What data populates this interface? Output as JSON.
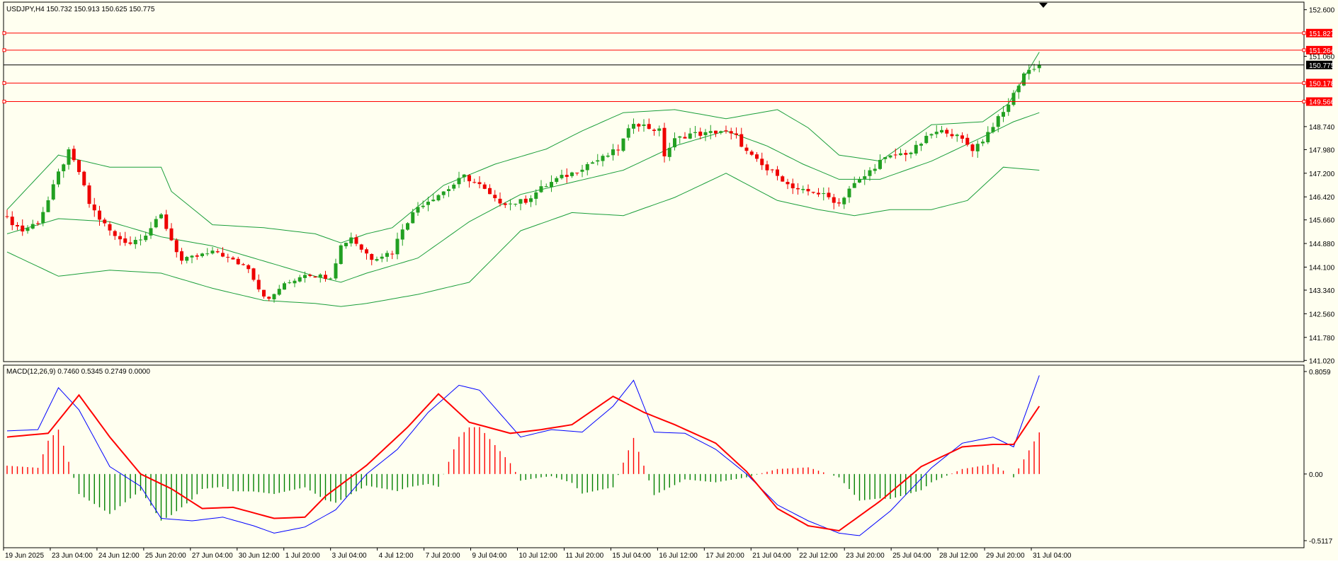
{
  "main_header": "USDJPY,H4  150.732 150.913 150.625 150.775",
  "macd_header": "MACD(12,26,9) 0.7460 0.5345 0.2749 0.0000",
  "colors": {
    "background": "#fffff0",
    "bull": "#22a022",
    "bear": "#ee0000",
    "bands": "#1a9e3a",
    "macd_line": "#0000ff",
    "signal_line": "#ff0000",
    "hist_pos": "#ff0000",
    "hist_neg": "#008000",
    "hline": "#ff0000",
    "price_line": "#000000"
  },
  "price_axis": {
    "ticks": [
      "152.600",
      "151.060",
      "148.740",
      "147.980",
      "147.200",
      "146.420",
      "145.660",
      "144.880",
      "144.100",
      "143.340",
      "142.560",
      "141.780",
      "141.020"
    ],
    "tick_values": [
      152.6,
      151.06,
      148.74,
      147.98,
      147.2,
      146.42,
      145.66,
      144.88,
      144.1,
      143.34,
      142.56,
      141.78,
      141.02
    ]
  },
  "macd_axis": {
    "ticks": [
      "0.8059",
      "0.00",
      "-0.5117"
    ],
    "tick_values": [
      0.8059,
      0.0,
      -0.5117
    ]
  },
  "horizontal_levels": [
    {
      "label": "151.827",
      "value": 151.827
    },
    {
      "label": "151.264",
      "value": 151.264
    },
    {
      "label": "150.178",
      "value": 150.178
    },
    {
      "label": "149.566",
      "value": 149.566
    }
  ],
  "current_price": {
    "label": "150.775",
    "value": 150.775
  },
  "time_labels": [
    "19 Jun 2025",
    "23 Jun 04:00",
    "24 Jun 12:00",
    "25 Jun 20:00",
    "27 Jun 04:00",
    "30 Jun 12:00",
    "1 Jul 20:00",
    "3 Jul 04:00",
    "4 Jul 12:00",
    "7 Jul 20:00",
    "9 Jul 04:00",
    "10 Jul 12:00",
    "11 Jul 20:00",
    "15 Jul 04:00",
    "16 Jul 12:00",
    "17 Jul 20:00",
    "21 Jul 04:00",
    "22 Jul 12:00",
    "23 Jul 20:00",
    "25 Jul 04:00",
    "28 Jul 12:00",
    "29 Jul 20:00",
    "31 Jul 04:00"
  ],
  "chart_data": {
    "type": "candlestick",
    "symbol": "USDJPY",
    "timeframe": "H4",
    "ylim": [
      140.98,
      152.85
    ],
    "close_path": [
      [
        0,
        145.7
      ],
      [
        3,
        145.3
      ],
      [
        6,
        145.6
      ],
      [
        8,
        146.3
      ],
      [
        10,
        147.2
      ],
      [
        12,
        147.9
      ],
      [
        14,
        147.25
      ],
      [
        16,
        146.2
      ],
      [
        18,
        145.7
      ],
      [
        21,
        145.1
      ],
      [
        24,
        144.9
      ],
      [
        27,
        145.2
      ],
      [
        30,
        145.8
      ],
      [
        32,
        145.0
      ],
      [
        34,
        144.3
      ],
      [
        36,
        144.4
      ],
      [
        38,
        144.5
      ],
      [
        41,
        144.6
      ],
      [
        44,
        144.3
      ],
      [
        47,
        144.1
      ],
      [
        49,
        143.4
      ],
      [
        51,
        143.0
      ],
      [
        53,
        143.4
      ],
      [
        55,
        143.6
      ],
      [
        58,
        143.9
      ],
      [
        61,
        143.8
      ],
      [
        63,
        143.8
      ],
      [
        65,
        144.8
      ],
      [
        67,
        145.1
      ],
      [
        69,
        144.7
      ],
      [
        71,
        144.4
      ],
      [
        73,
        144.5
      ],
      [
        75,
        144.6
      ],
      [
        77,
        145.4
      ],
      [
        80,
        146.1
      ],
      [
        83,
        146.4
      ],
      [
        86,
        146.7
      ],
      [
        89,
        147.1
      ],
      [
        92,
        146.8
      ],
      [
        95,
        146.3
      ],
      [
        98,
        146.2
      ],
      [
        101,
        146.3
      ],
      [
        104,
        146.7
      ],
      [
        107,
        147.0
      ],
      [
        110,
        147.2
      ],
      [
        113,
        147.5
      ],
      [
        116,
        147.7
      ],
      [
        119,
        148.0
      ],
      [
        122,
        148.9
      ],
      [
        125,
        148.7
      ],
      [
        127,
        148.6
      ],
      [
        128,
        147.8
      ],
      [
        130,
        148.3
      ],
      [
        133,
        148.5
      ],
      [
        136,
        148.5
      ],
      [
        139,
        148.6
      ],
      [
        142,
        148.4
      ],
      [
        144,
        147.9
      ],
      [
        146,
        147.6
      ],
      [
        148,
        147.3
      ],
      [
        150,
        147.2
      ],
      [
        152,
        146.8
      ],
      [
        154,
        146.6
      ],
      [
        157,
        146.6
      ],
      [
        160,
        146.4
      ],
      [
        162,
        146.2
      ],
      [
        164,
        146.7
      ],
      [
        167,
        147.1
      ],
      [
        170,
        147.6
      ],
      [
        173,
        147.8
      ],
      [
        176,
        147.9
      ],
      [
        178,
        148.2
      ],
      [
        180,
        148.5
      ],
      [
        183,
        148.6
      ],
      [
        186,
        148.3
      ],
      [
        188,
        148.0
      ],
      [
        190,
        148.3
      ],
      [
        192,
        148.8
      ],
      [
        194,
        149.2
      ],
      [
        196,
        149.8
      ],
      [
        198,
        150.5
      ],
      [
        200,
        150.7
      ],
      [
        201,
        150.78
      ]
    ],
    "bollinger_upper": [
      [
        0,
        146.0
      ],
      [
        10,
        147.8
      ],
      [
        20,
        147.4
      ],
      [
        30,
        147.4
      ],
      [
        32,
        146.6
      ],
      [
        40,
        145.5
      ],
      [
        50,
        145.4
      ],
      [
        60,
        145.2
      ],
      [
        65,
        144.9
      ],
      [
        70,
        145.2
      ],
      [
        75,
        145.4
      ],
      [
        85,
        146.8
      ],
      [
        95,
        147.5
      ],
      [
        105,
        148.0
      ],
      [
        112,
        148.6
      ],
      [
        120,
        149.2
      ],
      [
        130,
        149.3
      ],
      [
        140,
        149.0
      ],
      [
        150,
        149.3
      ],
      [
        156,
        148.7
      ],
      [
        162,
        147.8
      ],
      [
        170,
        147.6
      ],
      [
        180,
        148.8
      ],
      [
        190,
        148.9
      ],
      [
        195,
        149.5
      ],
      [
        201,
        151.2
      ]
    ],
    "bollinger_middle": [
      [
        0,
        145.2
      ],
      [
        10,
        145.7
      ],
      [
        20,
        145.6
      ],
      [
        30,
        145.1
      ],
      [
        40,
        144.8
      ],
      [
        50,
        144.3
      ],
      [
        60,
        143.8
      ],
      [
        65,
        143.6
      ],
      [
        70,
        143.9
      ],
      [
        80,
        144.4
      ],
      [
        90,
        145.6
      ],
      [
        100,
        146.5
      ],
      [
        110,
        146.9
      ],
      [
        120,
        147.3
      ],
      [
        130,
        148.1
      ],
      [
        140,
        148.6
      ],
      [
        148,
        148.1
      ],
      [
        155,
        147.5
      ],
      [
        162,
        147.0
      ],
      [
        170,
        147.0
      ],
      [
        180,
        147.6
      ],
      [
        190,
        148.4
      ],
      [
        196,
        148.9
      ],
      [
        201,
        149.2
      ]
    ],
    "bollinger_lower": [
      [
        0,
        144.6
      ],
      [
        10,
        143.8
      ],
      [
        20,
        144.0
      ],
      [
        30,
        143.9
      ],
      [
        40,
        143.4
      ],
      [
        50,
        143.0
      ],
      [
        60,
        142.9
      ],
      [
        65,
        142.8
      ],
      [
        70,
        142.9
      ],
      [
        80,
        143.2
      ],
      [
        90,
        143.6
      ],
      [
        100,
        145.3
      ],
      [
        110,
        145.9
      ],
      [
        120,
        145.8
      ],
      [
        130,
        146.4
      ],
      [
        140,
        147.2
      ],
      [
        150,
        146.3
      ],
      [
        158,
        146.0
      ],
      [
        165,
        145.8
      ],
      [
        172,
        146.0
      ],
      [
        180,
        146.0
      ],
      [
        187,
        146.3
      ],
      [
        194,
        147.4
      ],
      [
        201,
        147.3
      ]
    ],
    "macd": [
      [
        0,
        0.35
      ],
      [
        6,
        0.36
      ],
      [
        10,
        0.7
      ],
      [
        14,
        0.52
      ],
      [
        20,
        0.06
      ],
      [
        26,
        -0.1
      ],
      [
        30,
        -0.36
      ],
      [
        36,
        -0.38
      ],
      [
        42,
        -0.35
      ],
      [
        48,
        -0.42
      ],
      [
        52,
        -0.48
      ],
      [
        58,
        -0.43
      ],
      [
        64,
        -0.29
      ],
      [
        70,
        0.0
      ],
      [
        76,
        0.2
      ],
      [
        82,
        0.5
      ],
      [
        88,
        0.72
      ],
      [
        92,
        0.68
      ],
      [
        100,
        0.3
      ],
      [
        106,
        0.36
      ],
      [
        112,
        0.34
      ],
      [
        118,
        0.55
      ],
      [
        122,
        0.76
      ],
      [
        126,
        0.34
      ],
      [
        132,
        0.33
      ],
      [
        138,
        0.2
      ],
      [
        144,
        0.0
      ],
      [
        150,
        -0.25
      ],
      [
        156,
        -0.38
      ],
      [
        162,
        -0.48
      ],
      [
        166,
        -0.5
      ],
      [
        172,
        -0.3
      ],
      [
        180,
        0.05
      ],
      [
        186,
        0.25
      ],
      [
        192,
        0.3
      ],
      [
        196,
        0.22
      ],
      [
        201,
        0.8
      ]
    ],
    "signal": [
      [
        0,
        0.3
      ],
      [
        8,
        0.33
      ],
      [
        14,
        0.64
      ],
      [
        20,
        0.3
      ],
      [
        26,
        0.0
      ],
      [
        32,
        -0.12
      ],
      [
        38,
        -0.28
      ],
      [
        44,
        -0.27
      ],
      [
        52,
        -0.36
      ],
      [
        58,
        -0.35
      ],
      [
        62,
        -0.18
      ],
      [
        70,
        0.07
      ],
      [
        78,
        0.38
      ],
      [
        84,
        0.65
      ],
      [
        90,
        0.42
      ],
      [
        98,
        0.33
      ],
      [
        104,
        0.36
      ],
      [
        110,
        0.4
      ],
      [
        118,
        0.63
      ],
      [
        124,
        0.5
      ],
      [
        130,
        0.4
      ],
      [
        138,
        0.25
      ],
      [
        144,
        0.02
      ],
      [
        150,
        -0.28
      ],
      [
        156,
        -0.42
      ],
      [
        162,
        -0.46
      ],
      [
        170,
        -0.22
      ],
      [
        178,
        0.06
      ],
      [
        186,
        0.22
      ],
      [
        192,
        0.24
      ],
      [
        196,
        0.24
      ],
      [
        201,
        0.55
      ]
    ]
  }
}
